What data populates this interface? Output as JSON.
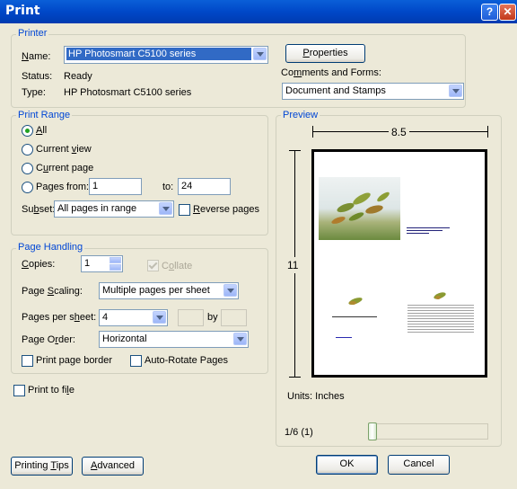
{
  "window": {
    "title": "Print",
    "help": "?",
    "close": "✕"
  },
  "printer": {
    "group": "Printer",
    "name_label": "Name:",
    "name_value": "HP Photosmart C5100 series",
    "status_label": "Status:",
    "status_value": "Ready",
    "type_label": "Type:",
    "type_value": "HP Photosmart C5100 series",
    "properties_button": "Properties",
    "comments_label": "Comments and Forms:",
    "comments_value": "Document and Stamps"
  },
  "print_range": {
    "group": "Print Range",
    "all": "All",
    "current_view": "Current view",
    "current_page": "Current page",
    "pages": "Pages",
    "from_label": "from:",
    "from_value": "1",
    "to_label": "to:",
    "to_value": "24",
    "subset_label": "Subset:",
    "subset_value": "All pages in range",
    "reverse_pages": "Reverse pages",
    "selected": "all"
  },
  "page_handling": {
    "group": "Page Handling",
    "copies_label": "Copies:",
    "copies_value": "1",
    "collate": "Collate",
    "scaling_label": "Page Scaling:",
    "scaling_value": "Multiple pages per sheet",
    "pps_label": "Pages per sheet:",
    "pps_value": "4",
    "by_label": "by",
    "order_label": "Page Order:",
    "order_value": "Horizontal",
    "print_border": "Print page border",
    "auto_rotate": "Auto-Rotate Pages"
  },
  "print_to_file": "Print to file",
  "preview": {
    "group": "Preview",
    "width": "8.5",
    "height": "11",
    "units": "Units: Inches",
    "page_indicator": "1/6 (1)",
    "thumb_title": "The Nub-Ex Green Grass"
  },
  "buttons": {
    "printing_tips": "Printing Tips",
    "advanced": "Advanced",
    "ok": "OK",
    "cancel": "Cancel"
  },
  "colors": {
    "accent": "#0046D5",
    "titlebar": "#0054E3",
    "dialog": "#ECE9D8"
  }
}
